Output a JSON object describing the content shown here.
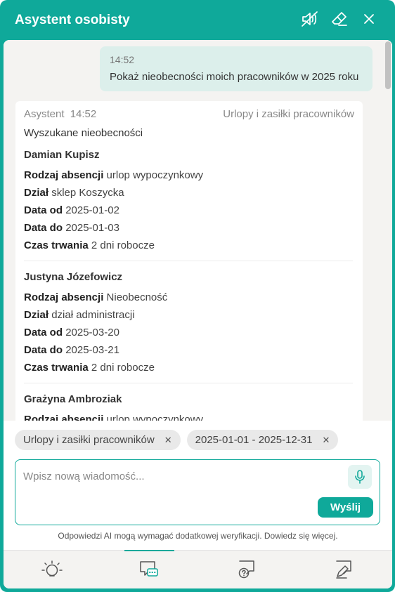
{
  "header": {
    "title": "Asystent osobisty",
    "icons": [
      "speaker-muted-icon",
      "eraser-icon",
      "close-icon"
    ]
  },
  "user_message": {
    "time": "14:52",
    "text": "Pokaż nieobecności moich pracowników w 2025 roku"
  },
  "bot_message": {
    "author": "Asystent",
    "time": "14:52",
    "category": "Urlopy i zasiłki pracowników",
    "intro": "Wyszukane nieobecności",
    "labels": {
      "type": "Rodzaj absencji",
      "dept": "Dział",
      "from": "Data od",
      "to": "Data do",
      "duration": "Czas trwania"
    },
    "people": [
      {
        "name": "Damian Kupisz",
        "type": "urlop wypoczynkowy",
        "dept": "sklep Koszycka",
        "from": "2025-01-02",
        "to": "2025-01-03",
        "duration": "2 dni robocze"
      },
      {
        "name": "Justyna Józefowicz",
        "type": "Nieobecność",
        "dept": "dział administracji",
        "from": "2025-03-20",
        "to": "2025-03-21",
        "duration": "2 dni robocze"
      },
      {
        "name": "Grażyna Ambroziak",
        "type": "urlop wypoczynkowy"
      }
    ]
  },
  "chips": [
    {
      "label": "Urlopy i zasiłki pracowników"
    },
    {
      "label": "2025-01-01 - 2025-12-31"
    }
  ],
  "composer": {
    "placeholder": "Wpisz nową wiadomość...",
    "send_label": "Wyślij"
  },
  "disclaimer": "Odpowiedzi AI mogą wymagać dodatkowej weryfikacji. Dowiedz się więcej.",
  "bottom_nav": [
    {
      "icon": "lightbulb-icon",
      "active": false
    },
    {
      "icon": "chat-icon",
      "active": true
    },
    {
      "icon": "help-chat-icon",
      "active": false
    },
    {
      "icon": "edit-chat-icon",
      "active": false
    }
  ],
  "colors": {
    "accent": "#0fa99a",
    "user_bubble": "#dcefeb",
    "chat_bg": "#f4f3f1"
  }
}
